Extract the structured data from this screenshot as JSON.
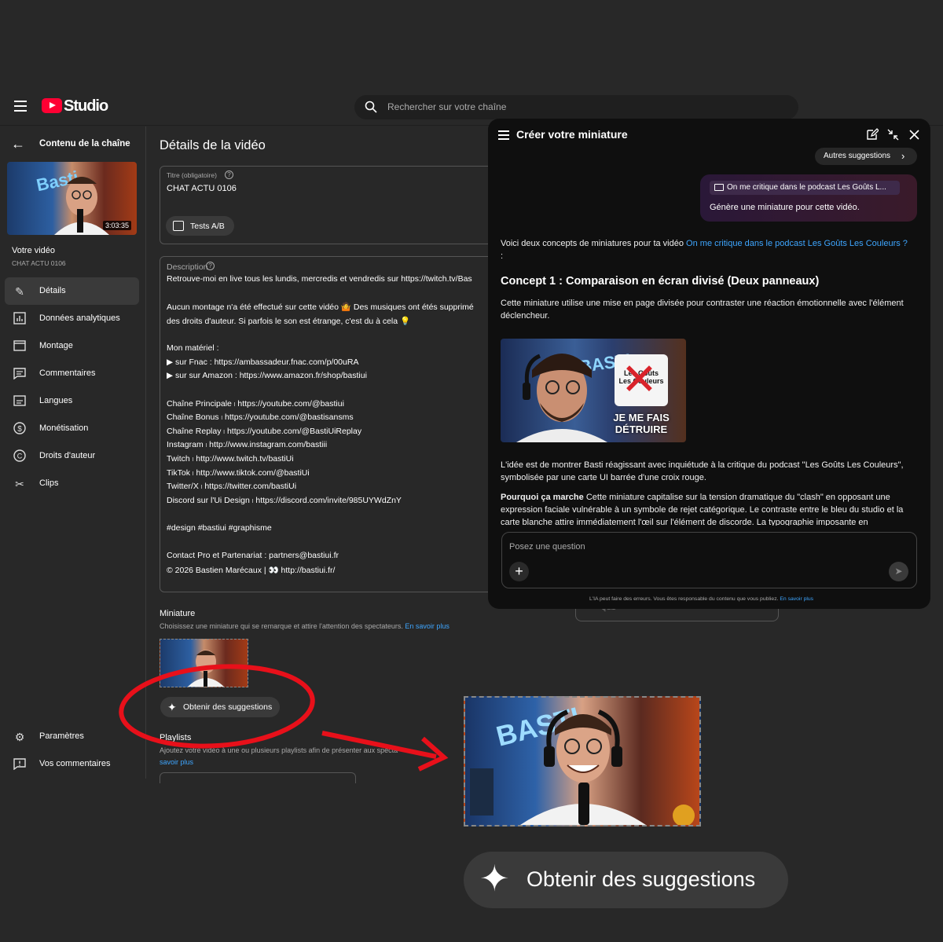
{
  "app": {
    "logo_text": "Studio",
    "search_placeholder": "Rechercher sur votre chaîne"
  },
  "sidebar": {
    "back_label": "Contenu de la chaîne",
    "thumb_duration": "3:03:35",
    "video_label": "Votre vidéo",
    "video_id": "CHAT ACTU 0106",
    "items": [
      {
        "label": "Détails",
        "icon": "pencil-icon",
        "active": true
      },
      {
        "label": "Données analytiques",
        "icon": "analytics-icon"
      },
      {
        "label": "Montage",
        "icon": "editor-icon"
      },
      {
        "label": "Commentaires",
        "icon": "comments-icon"
      },
      {
        "label": "Langues",
        "icon": "subtitles-icon"
      },
      {
        "label": "Monétisation",
        "icon": "dollar-icon"
      },
      {
        "label": "Droits d'auteur",
        "icon": "copyright-icon"
      },
      {
        "label": "Clips",
        "icon": "scissors-icon"
      }
    ],
    "bottom_items": [
      {
        "label": "Paramètres",
        "icon": "gear-icon"
      },
      {
        "label": "Vos commentaires",
        "icon": "feedback-icon"
      }
    ]
  },
  "main": {
    "page_title": "Détails de la vidéo",
    "title_field_label": "Titre (obligatoire)",
    "title_value": "CHAT ACTU 0106",
    "ab_test_label": "Tests A/B",
    "description_label": "Description",
    "description_lines": [
      "Retrouve-moi en live tous les lundis, mercredis et vendredis sur https://twitch.tv/Bas",
      "",
      "Aucun montage n'a été effectué sur cette vidéo 🤷 Des musiques ont étés supprimé",
      "des droits d'auteur. Si parfois le son est étrange, c'est du à cela 💡",
      "",
      "Mon matériel :",
      "▶ sur Fnac : https://ambassadeur.fnac.com/p/00uRA",
      "▶ sur sur Amazon : https://www.amazon.fr/shop/bastiui",
      "",
      "Chaîne Principale ၊ https://youtube.com/@bastiui",
      "Chaîne Bonus ၊ https://youtube.com/@bastisansms",
      "Chaîne Replay ၊ https://youtube.com/@BastiUiReplay",
      "Instagram ၊ http://www.instagram.com/bastiii",
      "Twitch ၊ http://www.twitch.tv/bastiUi",
      "TikTok ၊ http://www.tiktok.com/@bastiUi",
      "Twitter/X ၊ https://twitter.com/bastiUi",
      "Discord sur l'Ui Design ၊ https://discord.com/invite/985UYWdZnY",
      "",
      "#design #bastiui #graphisme",
      "",
      "Contact Pro et Partenariat : partners@bastiui.fr",
      "© 2026 Bastien Marécaux | 👀 http://bastiui.fr/"
    ],
    "thumbnail_title": "Miniature",
    "thumbnail_sub": "Choisissez une miniature qui se remarque et attire l'attention des spectateurs.",
    "learn_more": "En savoir plus",
    "suggestions_button": "Obtenir des suggestions",
    "playlists_title": "Playlists",
    "playlists_sub": "Ajoutez votre vidéo à une ou plusieurs playlists afin de présenter aux specta",
    "playlists_link": "savoir plus"
  },
  "panel": {
    "title": "Créer votre miniature",
    "other_suggestions": "Autres suggestions",
    "bubble_chip": "On me critique dans le podcast Les Goûts L...",
    "bubble_text": "Génère une miniature pour cette vidéo.",
    "intro_prefix": "Voici deux concepts de miniatures pour ta vidéo",
    "intro_link": "On me critique dans le podcast Les Goûts Les Couleurs ?",
    "intro_suffix": ":",
    "concept_title": "Concept 1 : Comparaison en écran divisé (Deux panneaux)",
    "concept_desc": "Cette miniature utilise une mise en page divisée pour contraster une réaction émotionnelle avec l'élément déclencheur.",
    "image_card_text": "Les Goûts Les Couleurs",
    "image_text": "JE ME FAIS DÉTRUIRE",
    "image_brand": "BASTI",
    "idea_text": "L'idée est de montrer Basti réagissant avec inquiétude à la critique du podcast \"Les Goûts Les Couleurs\", symbolisée par une carte UI barrée d'une croix rouge.",
    "why_label": "Pourquoi ça marche",
    "why_text": "Cette miniature capitalise sur la tension dramatique du \"clash\" en opposant une expression faciale vulnérable à un symbole de rejet catégorique. Le contraste entre le bleu du studio et la carte blanche attire immédiatement l'œil sur l'élément de discorde. La typographie imposante en",
    "ask_placeholder": "Posez une question",
    "disclaimer": "L'IA peut faire des erreurs. Vous êtes responsable du contenu que vous publiez.",
    "disclaimer_link": "En savoir plus",
    "behind_text": "Quiz"
  },
  "annotation": {
    "big_button": "Obtenir des suggestions",
    "circle_color": "#e8101a",
    "arrow_color": "#e8101a"
  }
}
